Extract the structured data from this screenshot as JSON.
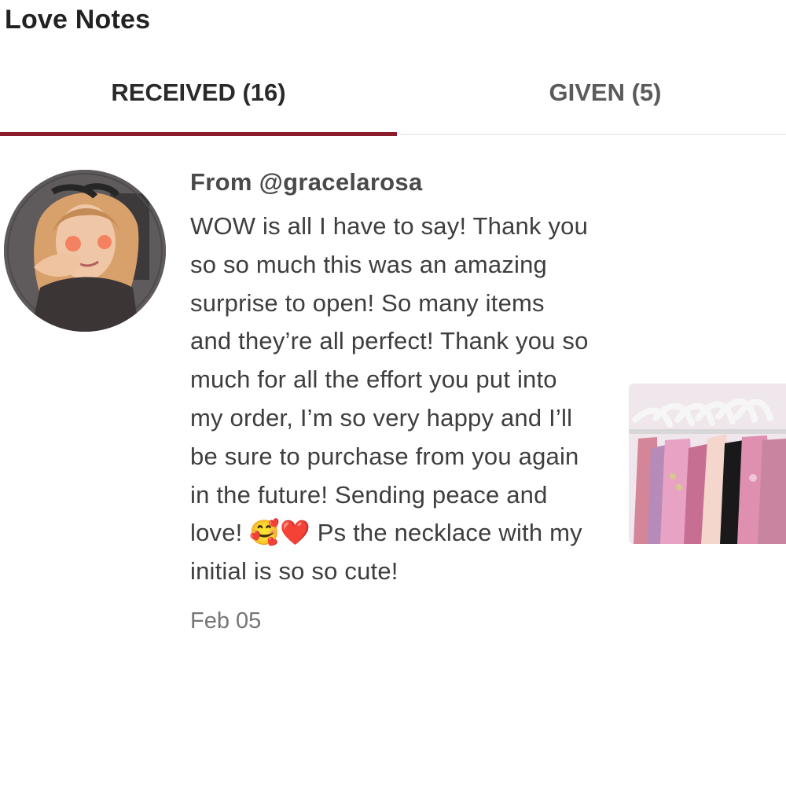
{
  "header": {
    "title": "Love Notes"
  },
  "tabs": [
    {
      "label": "RECEIVED (16)",
      "active": true
    },
    {
      "label": "GIVEN (5)",
      "active": false
    }
  ],
  "note": {
    "from": "From @gracelarosa",
    "message": "WOW is all I have to say! Thank you so so much this was an amazing surprise to open! So many items and they’re all perfect! Thank you so much for all the effort you put into my order, I’m so very happy and I’ll be sure to purchase from you again in the future! Sending peace and love! 🥰❤️ Ps the necklace with my initial is so so cute!",
    "date": "Feb 05"
  },
  "colors": {
    "accent": "#8c1c2b",
    "active_tab_text": "#2a2a2a",
    "inactive_tab_text": "#5b5b5b",
    "body_text": "#3e3e3e",
    "muted_text": "#757575"
  }
}
